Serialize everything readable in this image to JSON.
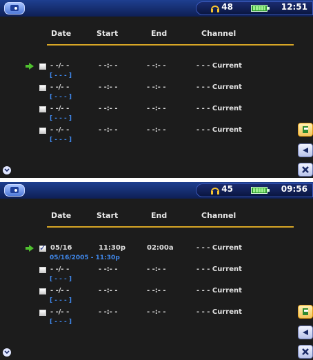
{
  "headers": {
    "date": "Date",
    "start": "Start",
    "end": "End",
    "channel": "Channel"
  },
  "panels": [
    {
      "status": {
        "volume": "48",
        "clock": "12:51"
      },
      "rows": [
        {
          "date": "- -/- -",
          "start": "- -:- -",
          "end": "- -:- -",
          "channel": "- - - Current",
          "sub": "[ - - - ]",
          "checked": false,
          "selected": true
        },
        {
          "date": "- -/- -",
          "start": "- -:- -",
          "end": "- -:- -",
          "channel": "- - - Current",
          "sub": "[ - - - ]",
          "checked": false,
          "selected": false
        },
        {
          "date": "- -/- -",
          "start": "- -:- -",
          "end": "- -:- -",
          "channel": "- - - Current",
          "sub": "[ - - - ]",
          "checked": false,
          "selected": false
        },
        {
          "date": "- -/- -",
          "start": "- -:- -",
          "end": "- -:- -",
          "channel": "- - - Current",
          "sub": "[ - - - ]",
          "checked": false,
          "selected": false
        }
      ]
    },
    {
      "status": {
        "volume": "45",
        "clock": "09:56"
      },
      "rows": [
        {
          "date": "05/16",
          "start": "11:30p",
          "end": "02:00a",
          "channel": "- - - Current",
          "sub": "05/16/2005 - 11:30p",
          "checked": true,
          "selected": true
        },
        {
          "date": "- -/- -",
          "start": "- -:- -",
          "end": "- -:- -",
          "channel": "- - - Current",
          "sub": "[ - - - ]",
          "checked": false,
          "selected": false
        },
        {
          "date": "- -/- -",
          "start": "- -:- -",
          "end": "- -:- -",
          "channel": "- - - Current",
          "sub": "[ - - - ]",
          "checked": false,
          "selected": false
        },
        {
          "date": "- -/- -",
          "start": "- -:- -",
          "end": "- -:- -",
          "channel": "- - - Current",
          "sub": "[ - - - ]",
          "checked": false,
          "selected": false
        }
      ]
    }
  ],
  "icons": {
    "app": "tv-icon",
    "headphones": "headphones-icon",
    "battery": "battery-icon",
    "exit": "exit-icon",
    "back": "back-arrow-icon",
    "close": "close-icon",
    "scroll": "scroll-down-icon",
    "selector": "selector-arrow-icon"
  },
  "colors": {
    "accent_line": "#d7a626",
    "subtext": "#3f86e8",
    "topbar": "#1e3f8f",
    "background": "#1c1c1c"
  }
}
